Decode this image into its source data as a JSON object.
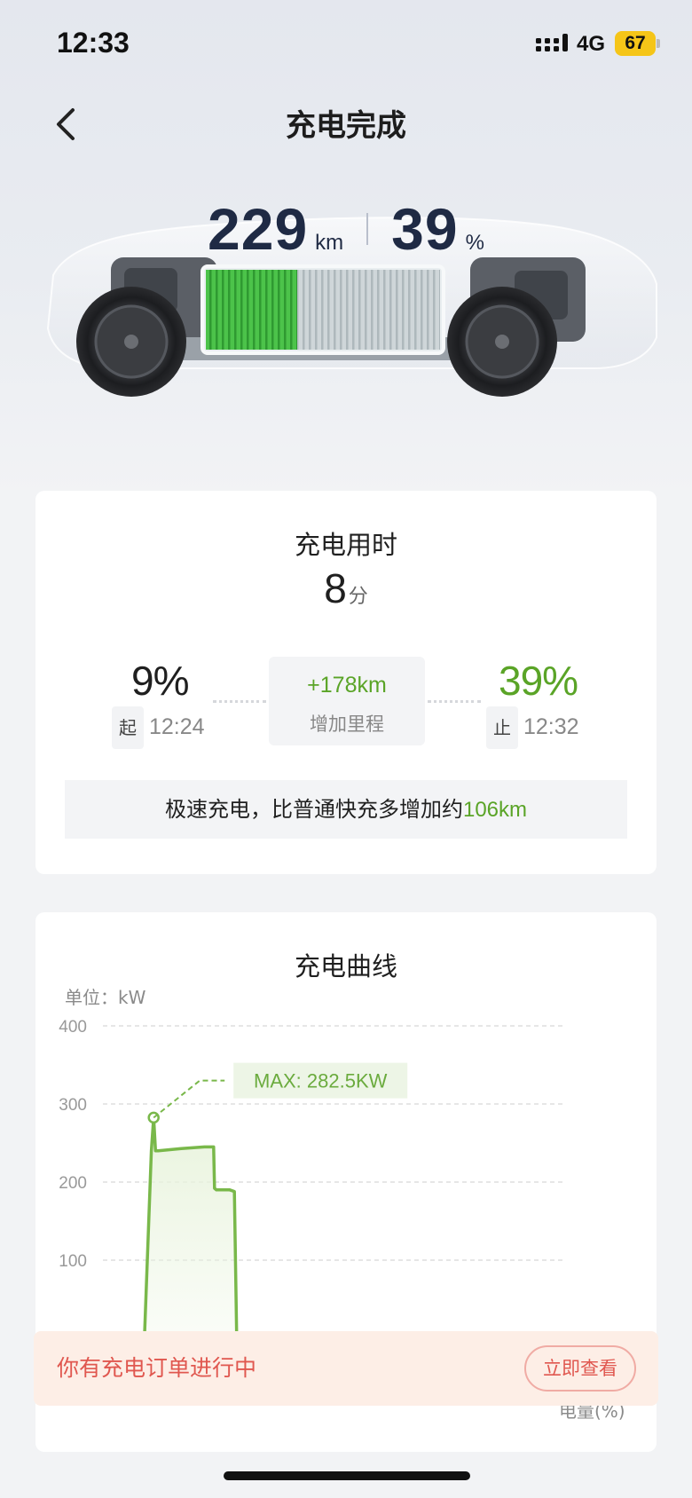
{
  "status_bar": {
    "time": "12:33",
    "network": "4G",
    "battery": "67",
    "icons": [
      "signal-icon",
      "battery-icon"
    ]
  },
  "header": {
    "title": "充电完成",
    "back_icon": "chevron-left-icon"
  },
  "hero": {
    "range_value": "229",
    "range_unit": "km",
    "soc_value": "39",
    "soc_unit": "%",
    "battery_fill_fraction": 0.39
  },
  "summary": {
    "title": "充电用时",
    "duration_value": "8",
    "duration_unit": "分",
    "start": {
      "percent": "9%",
      "tag": "起",
      "time": "12:24"
    },
    "end": {
      "percent": "39%",
      "tag": "止",
      "time": "12:32"
    },
    "range_added": "+178km",
    "range_added_label": "增加里程",
    "tip_text": "极速充电，比普通快充多增加约",
    "tip_highlight": "106km"
  },
  "curve": {
    "title": "充电曲线",
    "unit_label": "单位：kW",
    "x_axis_label": "电量(%)",
    "max_label": "MAX: 282.5KW"
  },
  "chart_data": {
    "type": "area",
    "title": "充电曲线",
    "ylabel": "单位：kW",
    "xlabel": "电量(%)",
    "ylim": [
      0,
      400
    ],
    "yticks": [
      "400",
      "300",
      "200",
      "100",
      "0"
    ],
    "grid": true,
    "series": [
      {
        "x": [
          9.0,
          10.5,
          11.0,
          11.4,
          12.0,
          17.0,
          22.0,
          24.0,
          24.2,
          24.6,
          27.5,
          28.5,
          29.0
        ],
        "values": [
          0,
          240,
          282.5,
          240,
          240,
          243,
          245,
          245,
          192,
          190,
          190,
          188,
          0
        ]
      }
    ],
    "xlim": [
      0,
      100
    ],
    "max_annotation": "MAX: 282.5KW",
    "colors": {
      "line": "#79b84a",
      "fill": "#e8f3dc"
    }
  },
  "order_banner": {
    "text": "你有充电订单进行中",
    "button_label": "立即查看"
  },
  "colors": {
    "accent_green": "#5aa427",
    "alert_red": "#e0574f",
    "hero_text": "#1f2a44"
  }
}
